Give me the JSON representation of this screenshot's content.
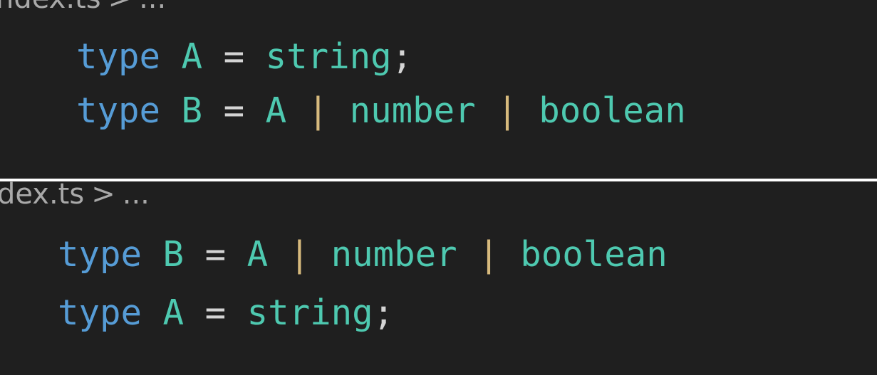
{
  "colors": {
    "editor_background": "#1f1f1f",
    "divider": "#ffffff",
    "breadcrumb": "#a9a9a9",
    "keyword": "#569cd6",
    "type_name": "#4ec9b0",
    "operator": "#d4d4d4",
    "pipe": "#d7ba7d"
  },
  "top_pane": {
    "breadcrumb": {
      "file": "ndex.ts",
      "separator": ">",
      "ellipsis": "..."
    },
    "lines": [
      {
        "kw": "type",
        "name": "A",
        "eq": "=",
        "t1": "string",
        "semi": ";"
      },
      {
        "kw": "type",
        "name": "B",
        "eq": "=",
        "t1": "A",
        "p1": "|",
        "t2": "number",
        "p2": "|",
        "t3": "boolean"
      }
    ]
  },
  "bottom_pane": {
    "breadcrumb": {
      "file": "dex.ts",
      "separator": ">",
      "ellipsis": "..."
    },
    "lines": [
      {
        "kw": "type",
        "name": "B",
        "eq": "=",
        "t1": "A",
        "p1": "|",
        "t2": "number",
        "p2": "|",
        "t3": "boolean"
      },
      {
        "kw": "type",
        "name": "A",
        "eq": "=",
        "t1": "string",
        "semi": ";"
      }
    ]
  }
}
